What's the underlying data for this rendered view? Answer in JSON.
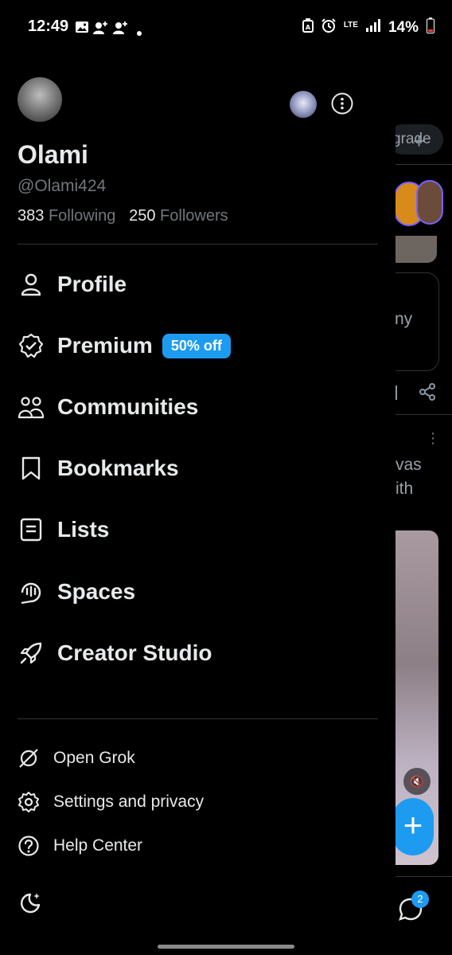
{
  "status_bar": {
    "time": "12:49",
    "network": "LTE",
    "battery": "14%",
    "icons": [
      "gallery-icon",
      "contact-add-icon",
      "contact-add-icon",
      "dot-icon",
      "data-saver-icon",
      "alarm-icon",
      "signal-icon",
      "battery-icon"
    ]
  },
  "profile": {
    "name": "Olami",
    "handle": "@Olami424",
    "following_count": "383",
    "following_label": "Following",
    "followers_count": "250",
    "followers_label": "Followers"
  },
  "menu": {
    "items": [
      {
        "label": "Profile",
        "icon": "person-icon"
      },
      {
        "label": "Premium",
        "icon": "verified-badge-icon",
        "badge": "50% off"
      },
      {
        "label": "Communities",
        "icon": "communities-icon"
      },
      {
        "label": "Bookmarks",
        "icon": "bookmark-icon"
      },
      {
        "label": "Lists",
        "icon": "list-icon"
      },
      {
        "label": "Spaces",
        "icon": "spaces-icon"
      },
      {
        "label": "Creator Studio",
        "icon": "rocket-icon"
      }
    ],
    "secondary": [
      {
        "label": "Open Grok",
        "icon": "grok-icon"
      },
      {
        "label": "Settings and privacy",
        "icon": "gear-icon"
      },
      {
        "label": "Help Center",
        "icon": "help-icon"
      }
    ]
  },
  "background": {
    "upgrade_text": "grade",
    "peek_text_1": "ny",
    "peek_text_2": "vas",
    "peek_text_3": "ith",
    "messages_badge": "2"
  },
  "colors": {
    "accent": "#1d9bf0",
    "background": "#000000",
    "text": "#e7e9ea",
    "muted": "#71767b",
    "divider": "#2f3336"
  }
}
